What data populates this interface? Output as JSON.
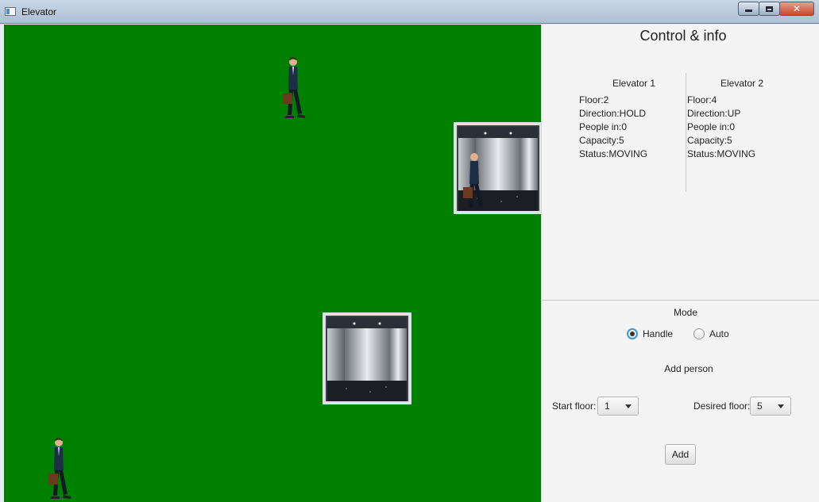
{
  "window": {
    "title": "Elevator",
    "minimize": "minimize",
    "maximize": "maximize",
    "close": "✕"
  },
  "simulation": {
    "background_color": "#008000"
  },
  "panel": {
    "title": "Control & info",
    "elevators": [
      {
        "header": "Elevator 1",
        "floor": "Floor:2",
        "direction": "Direction:HOLD",
        "people": "People in:0",
        "capacity": "Capacity:5",
        "status": "Status:MOVING"
      },
      {
        "header": "Elevator 2",
        "floor": "Floor:4",
        "direction": "Direction:UP",
        "people": "People in:0",
        "capacity": "Capacity:5",
        "status": "Status:MOVING"
      }
    ],
    "mode": {
      "label": "Mode",
      "options": [
        "Handle",
        "Auto"
      ],
      "selected": "Handle"
    },
    "add_person": {
      "label": "Add person",
      "start_floor_label": "Start floor:",
      "start_floor_value": "1",
      "desired_floor_label": "Desired floor:",
      "desired_floor_value": "5",
      "add_button": "Add"
    }
  },
  "colors": {
    "radio_selected": "#3a9ad9",
    "close_button": "#c8452c"
  }
}
